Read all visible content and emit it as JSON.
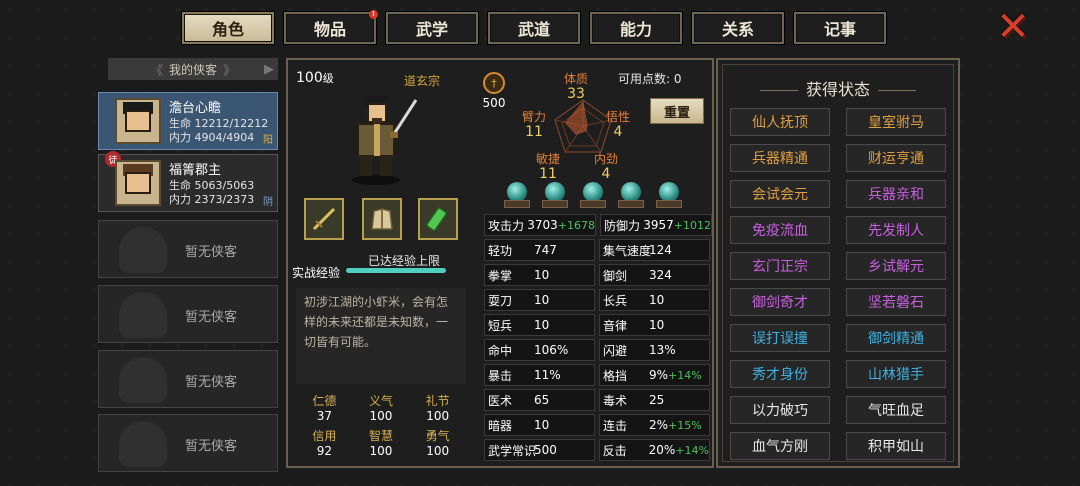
{
  "tabs": [
    {
      "label": "角色",
      "active": true,
      "notify": false
    },
    {
      "label": "物品",
      "active": false,
      "notify": true
    },
    {
      "label": "武学",
      "active": false,
      "notify": false
    },
    {
      "label": "武道",
      "active": false,
      "notify": false
    },
    {
      "label": "能力",
      "active": false,
      "notify": false
    },
    {
      "label": "关系",
      "active": false,
      "notify": false
    },
    {
      "label": "记事",
      "active": false,
      "notify": false
    }
  ],
  "tab_notify_symbol": "!",
  "close_symbol": "✕",
  "list": {
    "header": "我的侠客",
    "arrow_left": "《",
    "arrow_right": "》",
    "arrow_side": "▶",
    "heroes": [
      {
        "name": "澹台心瞻",
        "hp_label": "生命",
        "hp": "12212/12212",
        "mp_label": "内力",
        "mp": "4904/4904",
        "tag": "阳",
        "tag_color": "#e0b040",
        "active": true,
        "badge": ""
      },
      {
        "name": "福箐郡主",
        "hp_label": "生命",
        "hp": "5063/5063",
        "mp_label": "内力",
        "mp": "2373/2373",
        "tag": "阴",
        "tag_color": "#7aa0d0",
        "active": false,
        "badge": "徒"
      }
    ],
    "empty_label": "暂无侠客"
  },
  "character": {
    "level": "100",
    "level_suffix": "级",
    "sect": "道玄宗",
    "experience_label": "实战经验",
    "experience_text": "已达经验上限",
    "experience_progress": 1.0,
    "description": "初涉江湖的小虾米，会有怎样的未来还都是未知数，一切皆有可能。",
    "virtues": [
      {
        "name": "仁德",
        "value": "37"
      },
      {
        "name": "义气",
        "value": "100"
      },
      {
        "name": "礼节",
        "value": "100"
      },
      {
        "name": "信用",
        "value": "92"
      },
      {
        "name": "智慧",
        "value": "100"
      },
      {
        "name": "勇气",
        "value": "100"
      }
    ],
    "potential_value": "500",
    "available_points_label": "可用点数:",
    "available_points": "0",
    "reset_label": "重置",
    "attributes": {
      "tizhi": {
        "label": "体质",
        "value": "33"
      },
      "bili": {
        "label": "臂力",
        "value": "11"
      },
      "wuxing": {
        "label": "悟性",
        "value": "4"
      },
      "minjie": {
        "label": "敏捷",
        "value": "11"
      },
      "neijin": {
        "label": "内劲",
        "value": "4"
      }
    },
    "stats": [
      [
        {
          "name": "攻击力",
          "value": "3703",
          "bonus": "+1678"
        },
        {
          "name": "防御力",
          "value": "3957",
          "bonus": "+1012"
        }
      ],
      [
        {
          "name": "轻功",
          "value": "747",
          "bonus": ""
        },
        {
          "name": "集气速度",
          "value": "124",
          "bonus": ""
        }
      ],
      [
        {
          "name": "拳掌",
          "value": "10",
          "bonus": ""
        },
        {
          "name": "御剑",
          "value": "324",
          "bonus": ""
        }
      ],
      [
        {
          "name": "耍刀",
          "value": "10",
          "bonus": ""
        },
        {
          "name": "长兵",
          "value": "10",
          "bonus": ""
        }
      ],
      [
        {
          "name": "短兵",
          "value": "10",
          "bonus": ""
        },
        {
          "name": "音律",
          "value": "10",
          "bonus": ""
        }
      ],
      [
        {
          "name": "命中",
          "value": "106%",
          "bonus": ""
        },
        {
          "name": "闪避",
          "value": "13%",
          "bonus": ""
        }
      ],
      [
        {
          "name": "暴击",
          "value": "11%",
          "bonus": ""
        },
        {
          "name": "格挡",
          "value": "9%",
          "bonus": "+14%"
        }
      ],
      [
        {
          "name": "医术",
          "value": "65",
          "bonus": ""
        },
        {
          "name": "毒术",
          "value": "25",
          "bonus": ""
        }
      ],
      [
        {
          "name": "暗器",
          "value": "10",
          "bonus": ""
        },
        {
          "name": "连击",
          "value": "2%",
          "bonus": "+15%"
        }
      ],
      [
        {
          "name": "武学常识",
          "value": "500",
          "bonus": ""
        },
        {
          "name": "反击",
          "value": "20%",
          "bonus": "+14%"
        }
      ]
    ]
  },
  "status_panel": {
    "title": "获得状态",
    "items": [
      {
        "label": "仙人抚顶",
        "color": "#e0a040"
      },
      {
        "label": "皇室驸马",
        "color": "#e0a040"
      },
      {
        "label": "兵器精通",
        "color": "#e0a040"
      },
      {
        "label": "财运亨通",
        "color": "#e0a040"
      },
      {
        "label": "会试会元",
        "color": "#e0a040"
      },
      {
        "label": "兵器亲和",
        "color": "#c860e0"
      },
      {
        "label": "免疫流血",
        "color": "#c860e0"
      },
      {
        "label": "先发制人",
        "color": "#c860e0"
      },
      {
        "label": "玄门正宗",
        "color": "#c860e0"
      },
      {
        "label": "乡试解元",
        "color": "#c860e0"
      },
      {
        "label": "御剑奇才",
        "color": "#c860e0"
      },
      {
        "label": "坚若磐石",
        "color": "#c860e0"
      },
      {
        "label": "误打误撞",
        "color": "#40b0e0"
      },
      {
        "label": "御剑精通",
        "color": "#40b0e0"
      },
      {
        "label": "秀才身份",
        "color": "#40b0e0"
      },
      {
        "label": "山林猎手",
        "color": "#40b0e0"
      },
      {
        "label": "以力破巧",
        "color": "#e8e8e8"
      },
      {
        "label": "气旺血足",
        "color": "#e8e8e8"
      },
      {
        "label": "血气方刚",
        "color": "#e8e8e8"
      },
      {
        "label": "积甲如山",
        "color": "#e8e8e8"
      }
    ]
  }
}
